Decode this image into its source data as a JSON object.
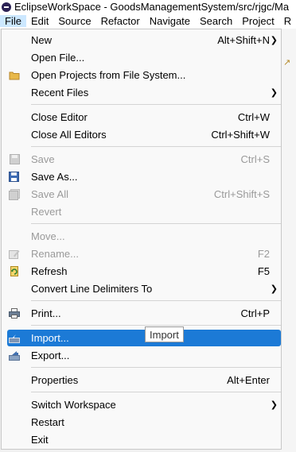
{
  "window": {
    "title": "EclipseWorkSpace - GoodsManagementSystem/src/rjgc/Ma"
  },
  "menubar": [
    "File",
    "Edit",
    "Source",
    "Refactor",
    "Navigate",
    "Search",
    "Project",
    "R"
  ],
  "menu": {
    "new": {
      "label": "New",
      "accel": "Alt+Shift+N"
    },
    "open_file": {
      "label": "Open File..."
    },
    "open_projects": {
      "label": "Open Projects from File System..."
    },
    "recent_files": {
      "label": "Recent Files"
    },
    "close_editor": {
      "label": "Close Editor",
      "accel": "Ctrl+W"
    },
    "close_all": {
      "label": "Close All Editors",
      "accel": "Ctrl+Shift+W"
    },
    "save": {
      "label": "Save",
      "accel": "Ctrl+S"
    },
    "save_as": {
      "label": "Save As..."
    },
    "save_all": {
      "label": "Save All",
      "accel": "Ctrl+Shift+S"
    },
    "revert": {
      "label": "Revert"
    },
    "move": {
      "label": "Move..."
    },
    "rename": {
      "label": "Rename...",
      "accel": "F2"
    },
    "refresh": {
      "label": "Refresh",
      "accel": "F5"
    },
    "convert": {
      "label": "Convert Line Delimiters To"
    },
    "print": {
      "label": "Print...",
      "accel": "Ctrl+P"
    },
    "import": {
      "label": "Import..."
    },
    "export": {
      "label": "Export..."
    },
    "properties": {
      "label": "Properties",
      "accel": "Alt+Enter"
    },
    "switch_ws": {
      "label": "Switch Workspace"
    },
    "restart": {
      "label": "Restart"
    },
    "exit": {
      "label": "Exit"
    }
  },
  "tooltip": {
    "text": "Import"
  },
  "colors": {
    "selection": "#1c7ad6",
    "menu_bg": "#f9f9f9",
    "disabled": "#9a9a9a"
  }
}
